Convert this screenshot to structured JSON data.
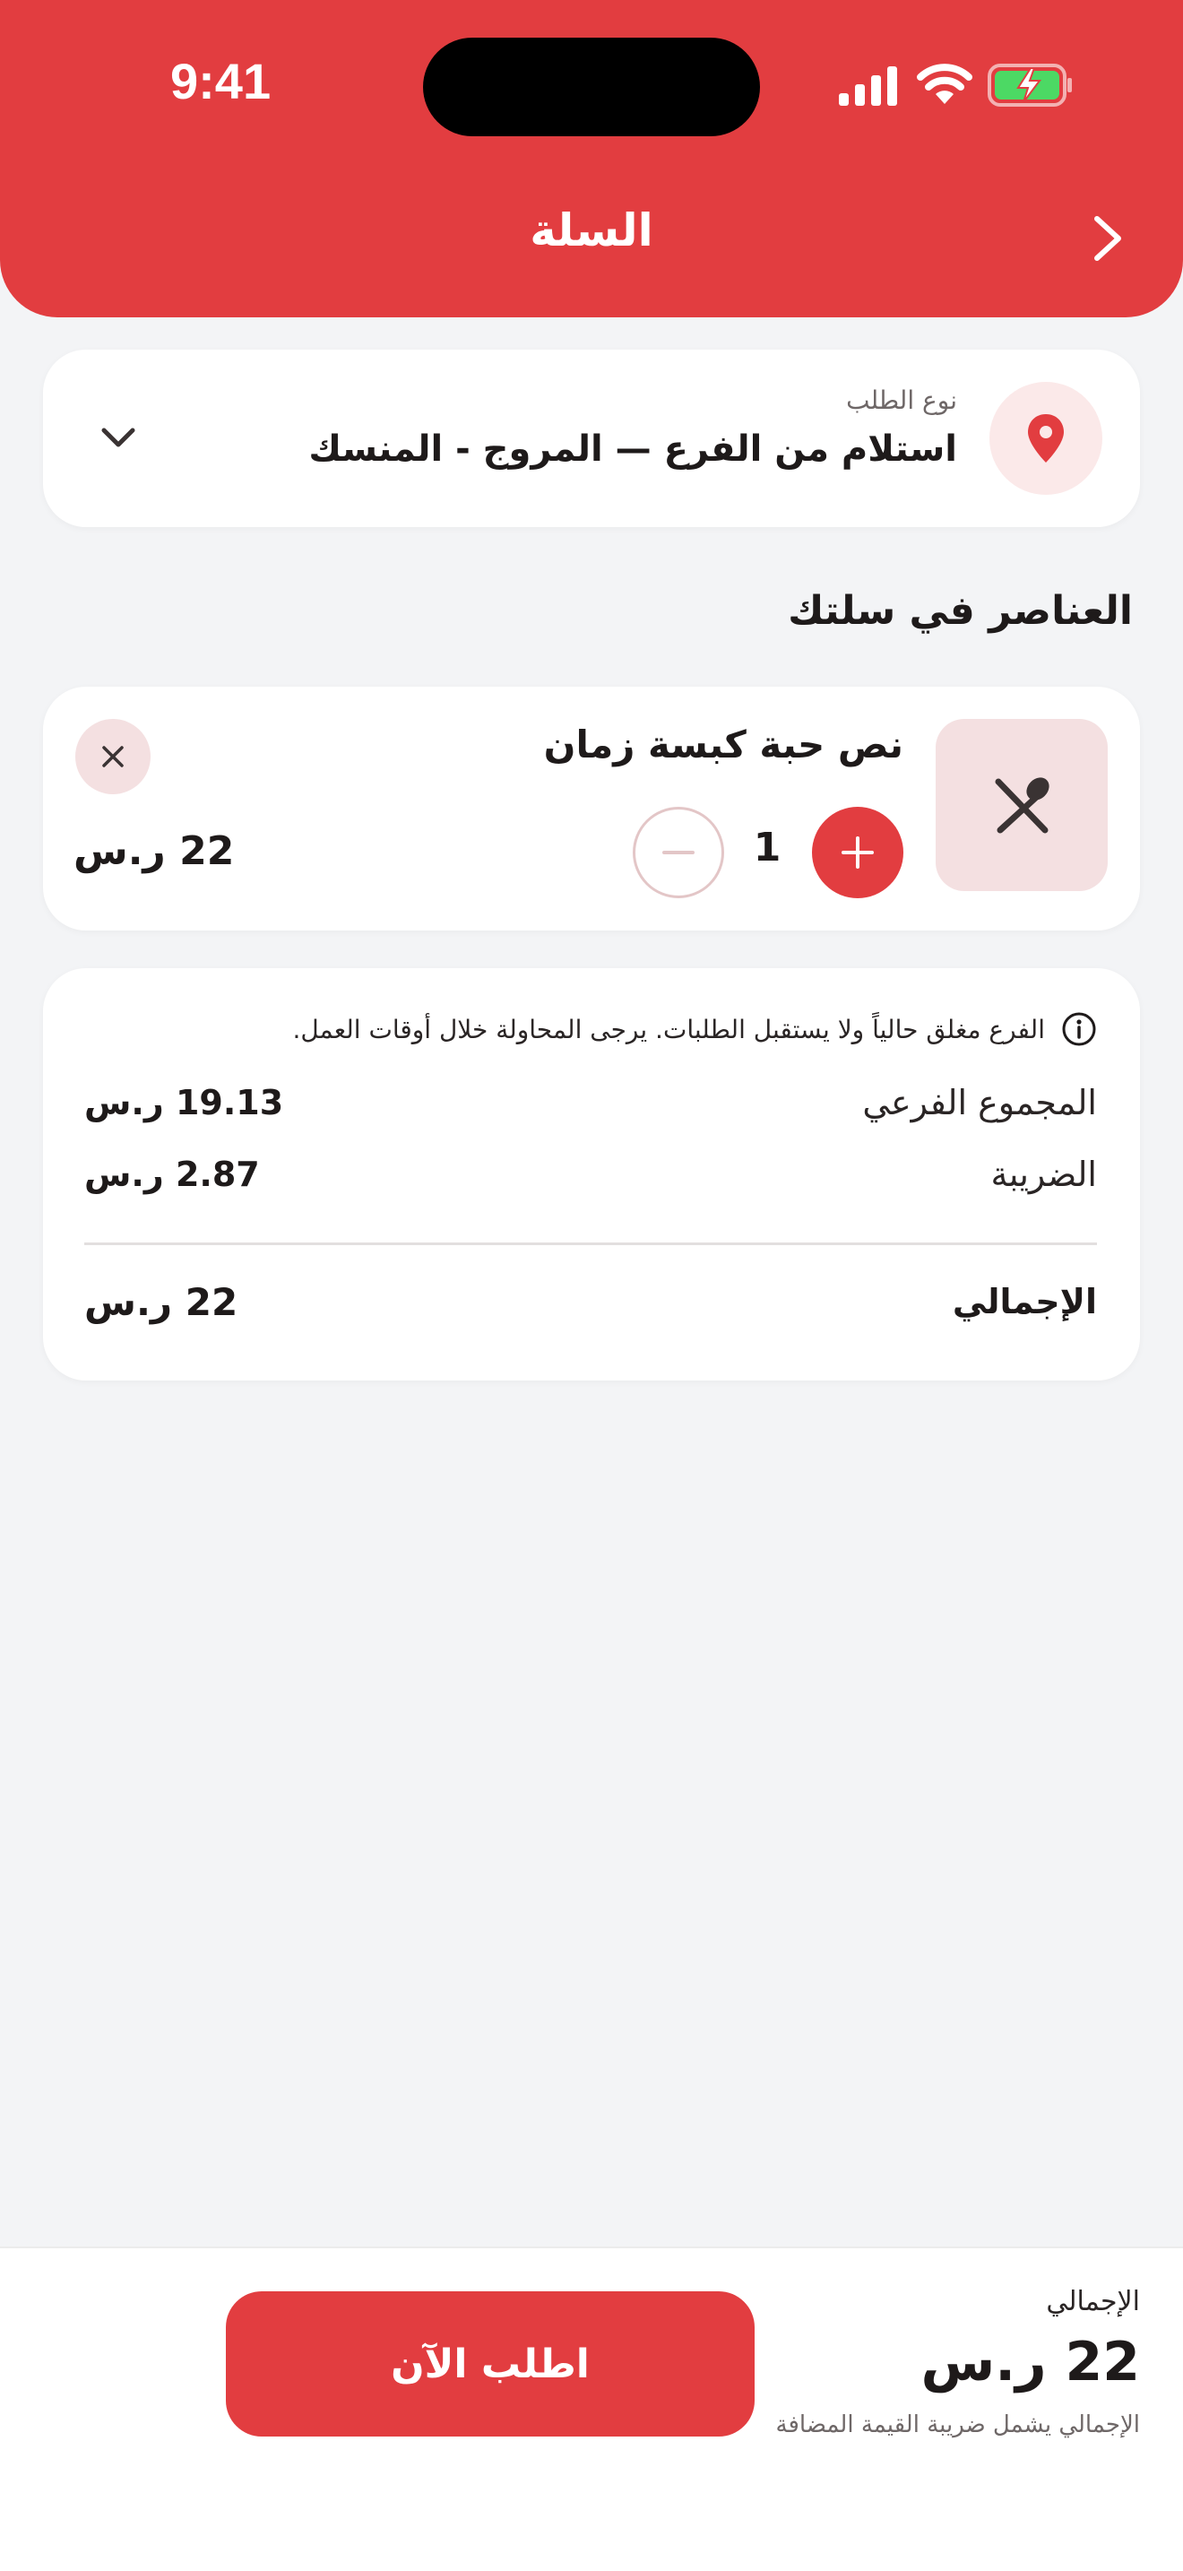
{
  "status_bar": {
    "time": "9:41"
  },
  "header": {
    "title": "السلة",
    "back_icon": "chevron-right-icon"
  },
  "order_type": {
    "label": "نوع الطلب",
    "value": "استلام من الفرع — المروج - المنسك",
    "icon": "location-pin-icon"
  },
  "cart": {
    "section_title": "العناصر في سلتك",
    "items": [
      {
        "name": "نص حبة كبسة زمان",
        "quantity": "1",
        "price": "22 ر.س",
        "icon": "utensils-icon"
      }
    ]
  },
  "summary": {
    "notice": "الفرع مغلق حالياً ولا يستقبل الطلبات. يرجى المحاولة خلال أوقات العمل.",
    "subtotal_label": "المجموع الفرعي",
    "subtotal_value": "19.13 ر.س",
    "tax_label": "الضريبة",
    "tax_value": "2.87 ر.س",
    "total_label": "الإجمالي",
    "total_value": "22 ر.س"
  },
  "bottom_bar": {
    "total_label": "الإجمالي",
    "total_value": "22 ر.س",
    "vat_note": "الإجمالي يشمل ضريبة القيمة المضافة",
    "order_button": "اطلب الآن"
  },
  "colors": {
    "brand": "#e23d40",
    "brand_light": "#f4e0e1",
    "background": "#f3f4f6",
    "battery": "#4cd964"
  }
}
